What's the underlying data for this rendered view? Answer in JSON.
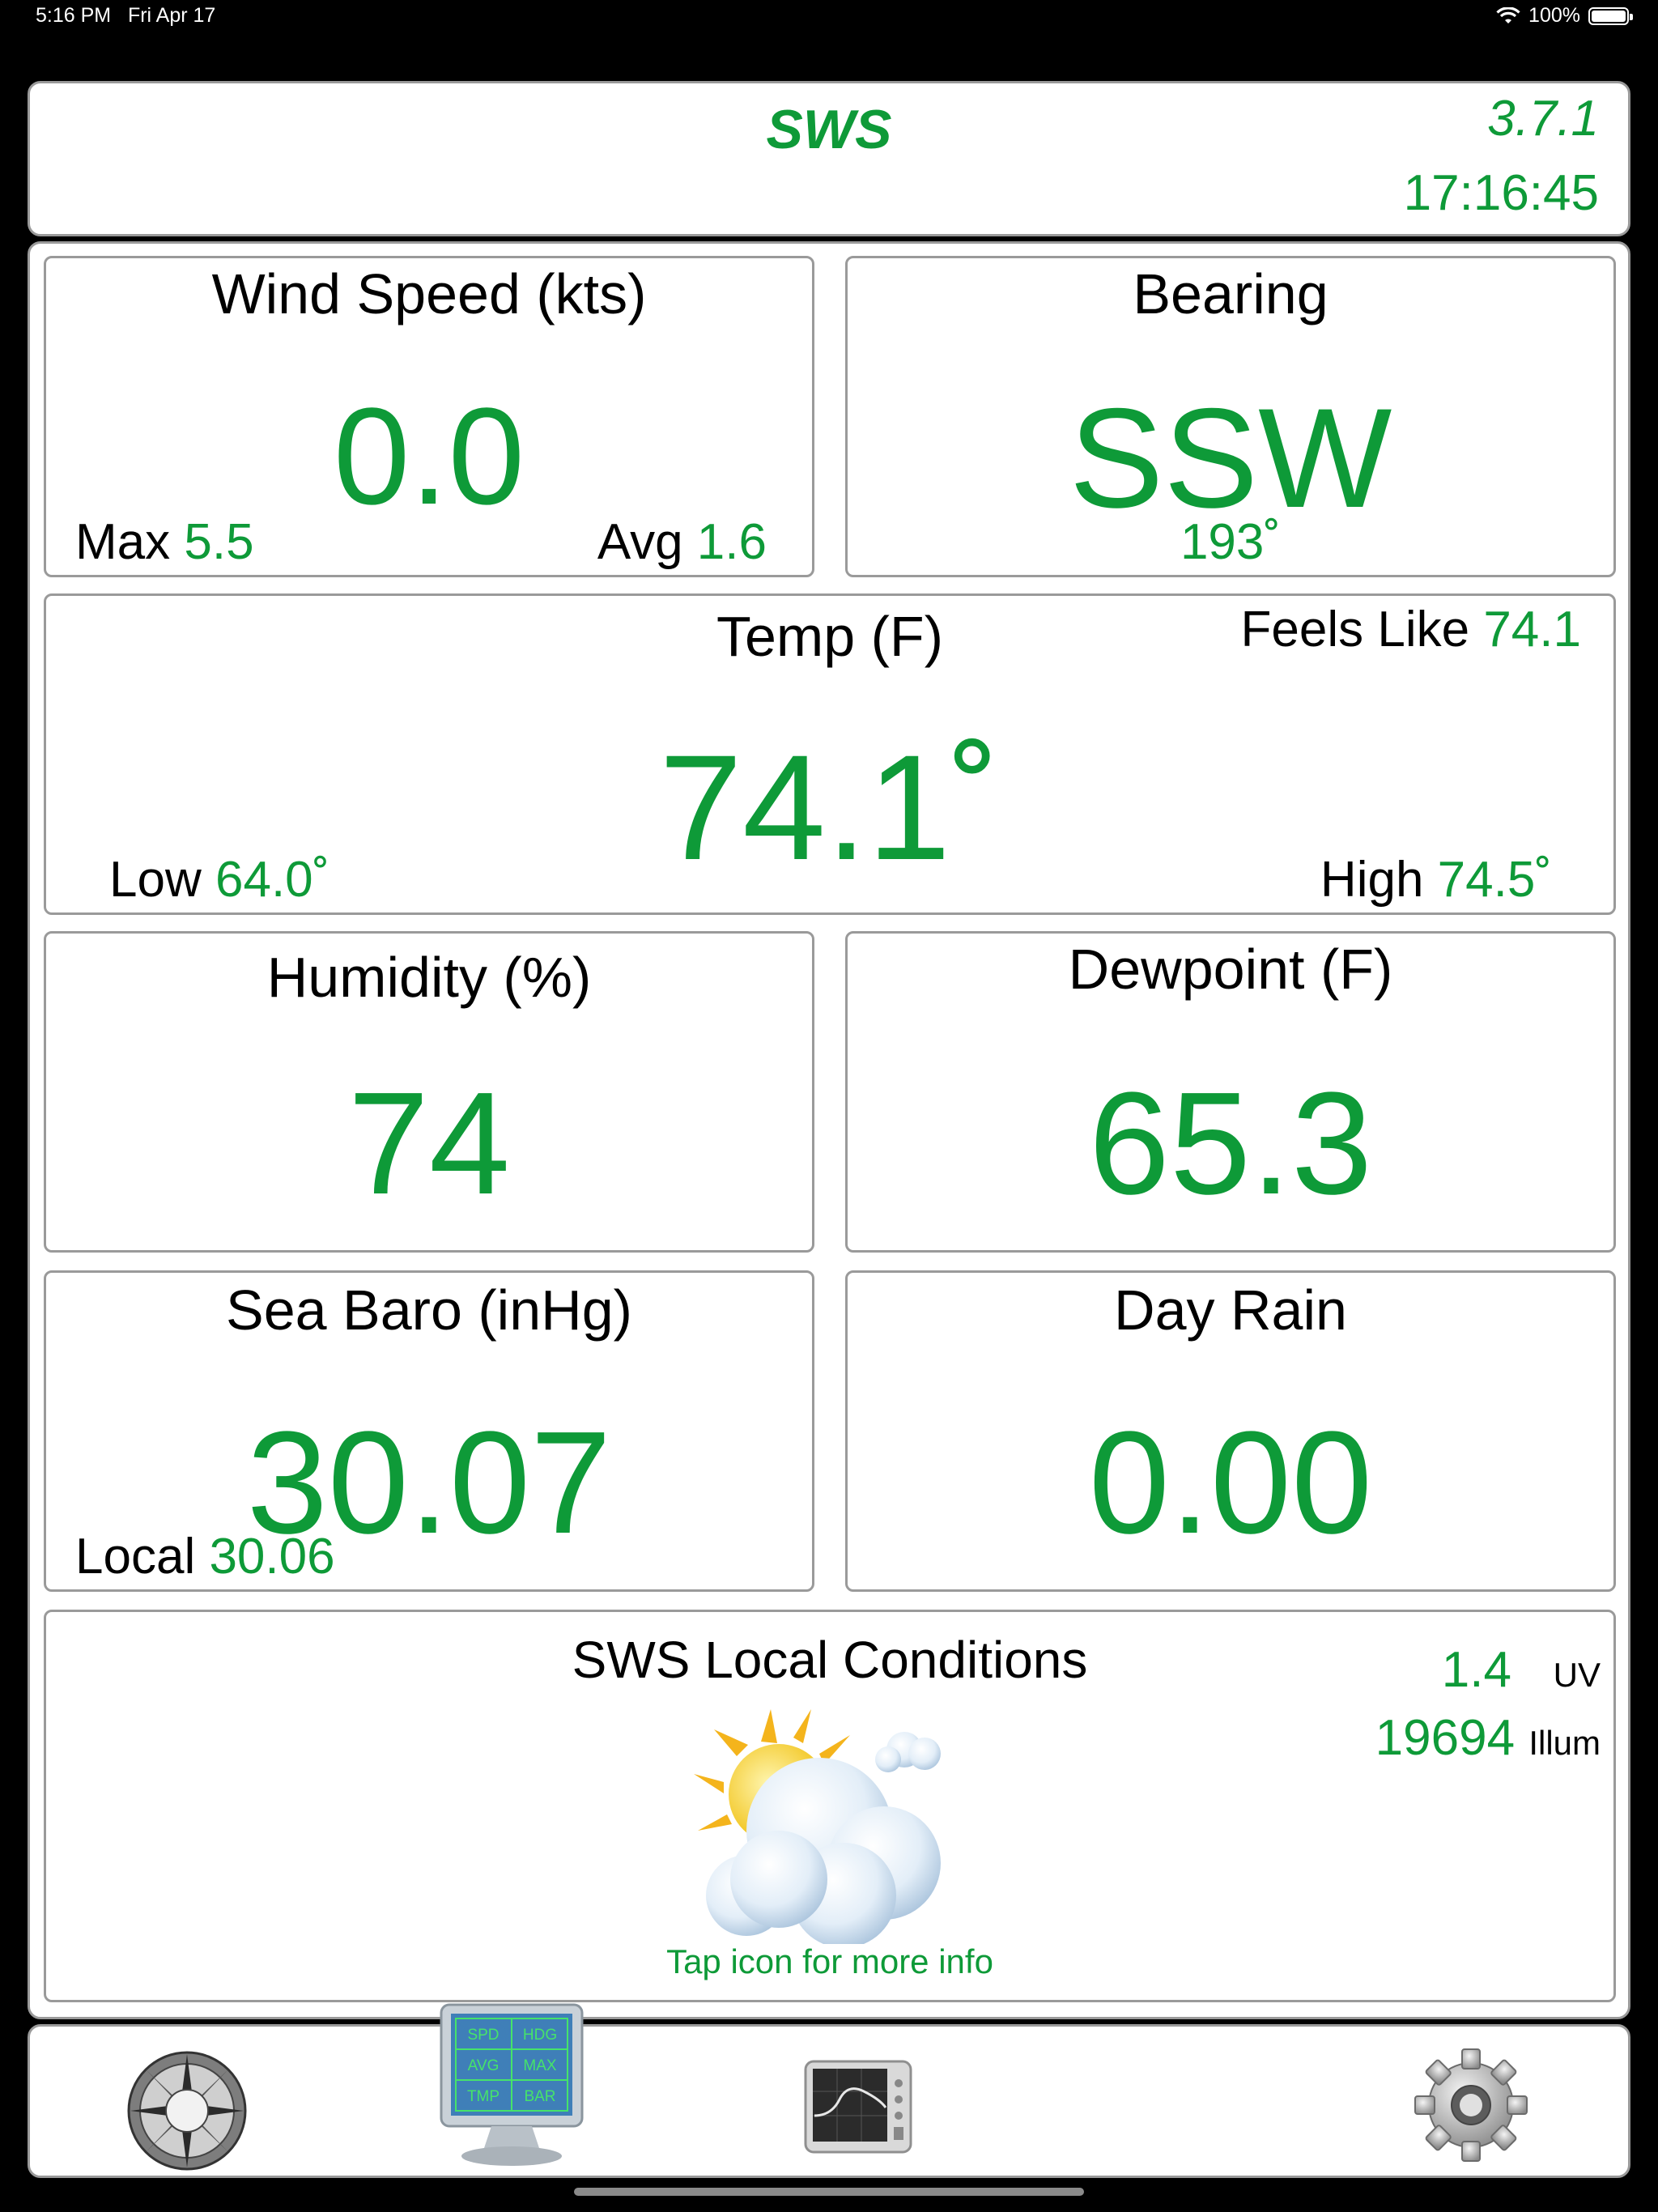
{
  "status_bar": {
    "time": "5:16 PM",
    "date": "Fri Apr 17",
    "battery": "100%",
    "battery_level": 1.0
  },
  "header": {
    "title": "SWS",
    "version": "3.7.1",
    "clock": "17:16:45"
  },
  "wind": {
    "title": "Wind Speed (kts)",
    "value": "0.0",
    "max_label": "Max",
    "max_value": "5.5",
    "avg_label": "Avg",
    "avg_value": "1.6"
  },
  "bearing": {
    "title": "Bearing",
    "value": "SSW",
    "degrees": "193˚"
  },
  "temp": {
    "title": "Temp (F)",
    "value": "74.1˚",
    "feels_label": "Feels Like",
    "feels_value": "74.1",
    "low_label": "Low",
    "low_value": "64.0˚",
    "high_label": "High",
    "high_value": "74.5˚"
  },
  "humidity": {
    "title": "Humidity (%)",
    "value": "74"
  },
  "dewpoint": {
    "title": "Dewpoint (F)",
    "value": "65.3"
  },
  "baro": {
    "title": "Sea Baro (inHg)",
    "value": "30.07",
    "local_label": "Local",
    "local_value": "30.06"
  },
  "rain": {
    "title": "Day Rain",
    "value": "0.00"
  },
  "conditions": {
    "title": "SWS Local Conditions",
    "uv_value": "1.4",
    "uv_label": "UV",
    "illum_value": "19694",
    "illum_label": "Illum",
    "tap_hint": "Tap icon for more info",
    "icon": "partly-cloudy-icon"
  },
  "tab_icons": {
    "compass": "compass-rose-icon",
    "display": "data-monitor-icon",
    "graph": "graph-monitor-icon",
    "settings": "gear-icon"
  },
  "monitor_labels": [
    "SPD",
    "HDG",
    "AVG",
    "MAX",
    "TMP",
    "BAR"
  ],
  "colors": {
    "accent": "#0e9a38",
    "border": "#9a9a9a",
    "background": "#000000"
  }
}
